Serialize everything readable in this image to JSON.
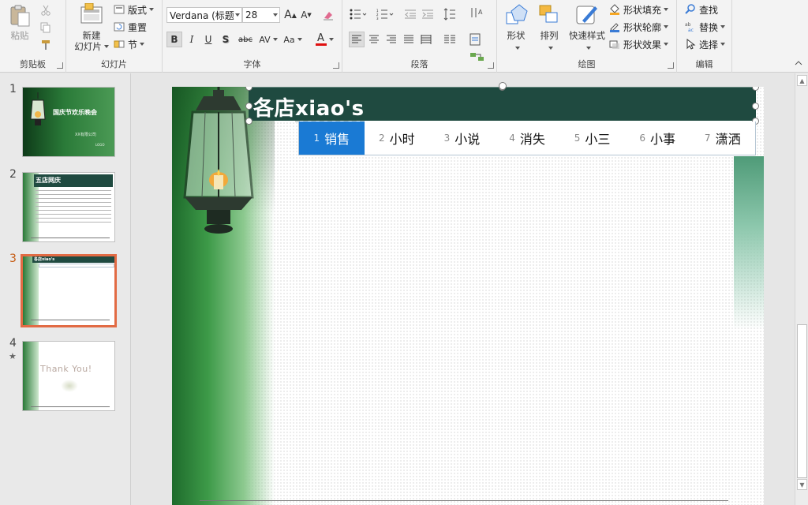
{
  "ribbon": {
    "clipboard": {
      "paste_label": "粘贴",
      "group_label": "剪贴板"
    },
    "slides": {
      "new_slide_label_1": "新建",
      "new_slide_label_2": "幻灯片",
      "layout_label": "版式",
      "reset_label": "重置",
      "section_label": "节",
      "group_label": "幻灯片"
    },
    "font": {
      "font_name": "Verdana (标题",
      "font_size": "28",
      "grow_label": "A",
      "shrink_label": "A",
      "bold": "B",
      "italic": "I",
      "underline": "U",
      "shadow": "S",
      "strike": "abc",
      "spacing": "AV",
      "case": "Aa",
      "color_label": "A",
      "group_label": "字体"
    },
    "paragraph": {
      "group_label": "段落"
    },
    "drawing": {
      "shapes_label": "形状",
      "arrange_label": "排列",
      "quick_styles_label": "快速样式",
      "fill_label": "形状填充",
      "outline_label": "形状轮廓",
      "effects_label": "形状效果",
      "group_label": "绘图"
    },
    "editing": {
      "find_label": "查找",
      "replace_label": "替换",
      "select_label": "选择",
      "group_label": "编辑"
    }
  },
  "thumbnails": [
    {
      "number": "1",
      "title": "国庆节欢乐晚会",
      "subtitle": "XX有限公司",
      "logo": "LOGO"
    },
    {
      "number": "2",
      "title": "五店网庆"
    },
    {
      "number": "3",
      "title": "各店xiao's",
      "active": true
    },
    {
      "number": "4",
      "star": "★",
      "text": "Thank You!"
    }
  ],
  "slide": {
    "title_prefix": "各店",
    "title_suffix": "xiao's",
    "tabs": [
      {
        "num": "1",
        "label": "销售",
        "active": true
      },
      {
        "num": "2",
        "label": "小时"
      },
      {
        "num": "3",
        "label": "小说"
      },
      {
        "num": "4",
        "label": "消失"
      },
      {
        "num": "5",
        "label": "小三"
      },
      {
        "num": "6",
        "label": "小事"
      },
      {
        "num": "7",
        "label": "潇洒"
      }
    ]
  },
  "colors": {
    "accent": "#1a7ad4",
    "title_bg": "#1f4a40",
    "selected_thumb_border": "#e26b44"
  }
}
